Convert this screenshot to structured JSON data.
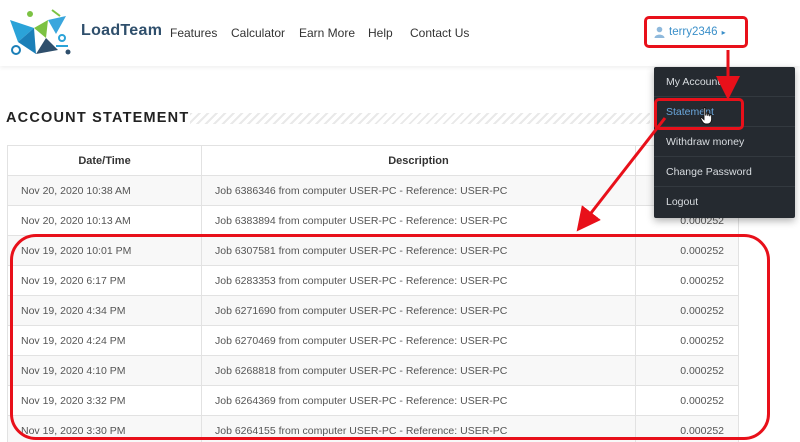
{
  "brand": {
    "name": "LoadTeam"
  },
  "nav": {
    "features": "Features",
    "calculator": "Calculator",
    "earn_more": "Earn More",
    "help": "Help",
    "contact": "Contact Us"
  },
  "user": {
    "name": "terry2346"
  },
  "dropdown": {
    "items": [
      "My Account",
      "Statement",
      "Withdraw money",
      "Change Password",
      "Logout"
    ],
    "active_index": 1
  },
  "page": {
    "title": "ACCOUNT STATEMENT"
  },
  "table": {
    "headers": [
      "Date/Time",
      "Description",
      ""
    ],
    "rows": [
      [
        "Nov 20, 2020 10:38 AM",
        "Job 6386346 from computer USER-PC - Reference: USER-PC",
        ""
      ],
      [
        "Nov 20, 2020 10:13 AM",
        "Job 6383894 from computer USER-PC - Reference: USER-PC",
        "0.000252"
      ],
      [
        "Nov 19, 2020 10:01 PM",
        "Job 6307581 from computer USER-PC - Reference: USER-PC",
        "0.000252"
      ],
      [
        "Nov 19, 2020 6:17 PM",
        "Job 6283353 from computer USER-PC - Reference: USER-PC",
        "0.000252"
      ],
      [
        "Nov 19, 2020 4:34 PM",
        "Job 6271690 from computer USER-PC - Reference: USER-PC",
        "0.000252"
      ],
      [
        "Nov 19, 2020 4:24 PM",
        "Job 6270469 from computer USER-PC - Reference: USER-PC",
        "0.000252"
      ],
      [
        "Nov 19, 2020 4:10 PM",
        "Job 6268818 from computer USER-PC - Reference: USER-PC",
        "0.000252"
      ],
      [
        "Nov 19, 2020 3:32 PM",
        "Job 6264369 from computer USER-PC - Reference: USER-PC",
        "0.000252"
      ],
      [
        "Nov 19, 2020 3:30 PM",
        "Job 6264155 from computer USER-PC - Reference: USER-PC",
        "0.000252"
      ]
    ]
  },
  "colors": {
    "annotation_red": "#e8101a",
    "link_blue": "#3a8fc9",
    "dropdown_bg": "#252a30",
    "brand_navy": "#2f4f6c"
  },
  "icons": {
    "user": "user-icon",
    "caret": "caret-right-icon",
    "cursor": "hand-pointer-icon"
  }
}
